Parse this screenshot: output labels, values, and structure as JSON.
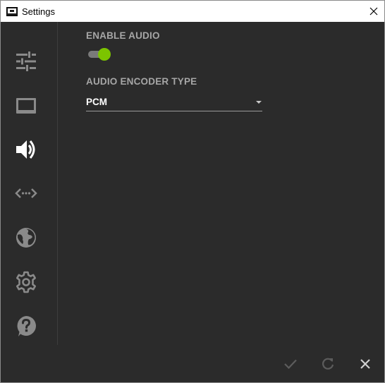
{
  "window": {
    "title": "Settings"
  },
  "sidebar": {
    "items": [
      {
        "icon": "sliders-icon",
        "active": false
      },
      {
        "icon": "display-icon",
        "active": false
      },
      {
        "icon": "speaker-icon",
        "active": true
      },
      {
        "icon": "network-arrows-icon",
        "active": false
      },
      {
        "icon": "globe-icon",
        "active": false
      },
      {
        "icon": "gear-icon",
        "active": false
      },
      {
        "icon": "help-icon",
        "active": false
      }
    ]
  },
  "audio": {
    "enable_label": "ENABLE AUDIO",
    "enabled": true,
    "encoder_label": "AUDIO ENCODER TYPE",
    "encoder_value": "PCM"
  },
  "colors": {
    "background": "#2b2b2b",
    "accent": "#7cc400",
    "icon_inactive": "#8a8a8a",
    "icon_active": "#ffffff",
    "label": "#a6a6a6"
  },
  "footer": {
    "apply_icon": "check-icon",
    "reset_icon": "refresh-icon",
    "close_icon": "close-icon"
  }
}
